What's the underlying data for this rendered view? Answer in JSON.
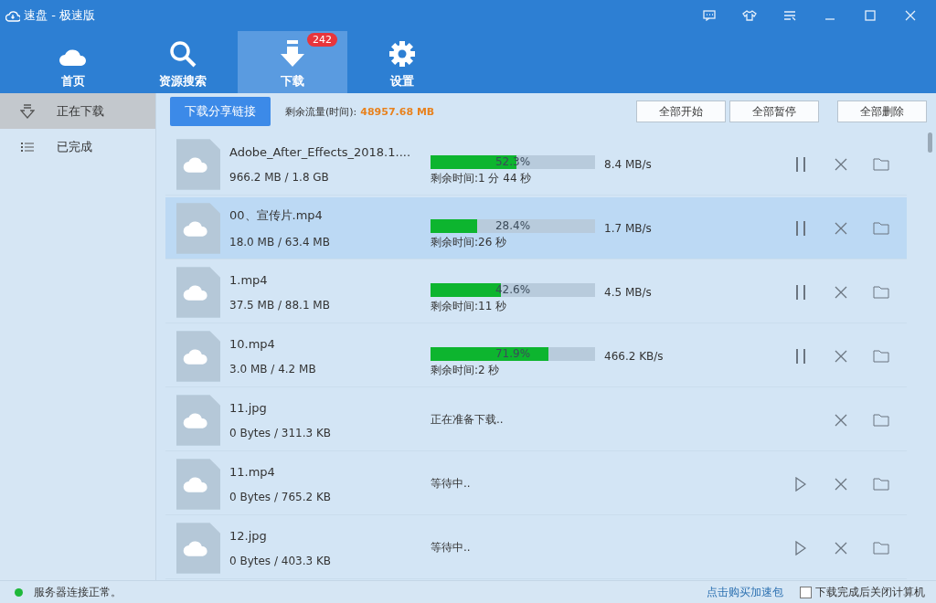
{
  "window": {
    "title": "速盘 - 极速版"
  },
  "nav": [
    {
      "label": "首页",
      "selected": false
    },
    {
      "label": "资源搜索",
      "selected": false
    },
    {
      "label": "下载",
      "selected": true,
      "badge": "242"
    },
    {
      "label": "设置",
      "selected": false
    }
  ],
  "sidebar": {
    "items": [
      {
        "label": "正在下载",
        "selected": true
      },
      {
        "label": "已完成",
        "selected": false
      }
    ]
  },
  "toolbar": {
    "share_button": "下载分享链接",
    "quota_label": "剩余流量(时间):",
    "quota_value": "48957.68 MB",
    "buttons": [
      "全部开始",
      "全部暂停",
      "全部删除"
    ]
  },
  "downloads": [
    {
      "name": "Adobe_After_Effects_2018.1....",
      "size": "966.2 MB / 1.8 GB",
      "kind": "downloading",
      "level": 0.523,
      "percent": "52.3%",
      "remaining": "剩余时间:1 分 44 秒",
      "speed": "8.4 MB/s",
      "selected": false
    },
    {
      "name": "00、宣传片.mp4",
      "size": "18.0 MB / 63.4 MB",
      "kind": "downloading",
      "level": 0.284,
      "percent": "28.4%",
      "remaining": "剩余时间:26 秒",
      "speed": "1.7 MB/s",
      "selected": true
    },
    {
      "name": "1.mp4",
      "size": "37.5 MB / 88.1 MB",
      "kind": "downloading",
      "level": 0.426,
      "percent": "42.6%",
      "remaining": "剩余时间:11 秒",
      "speed": "4.5 MB/s",
      "selected": false
    },
    {
      "name": "10.mp4",
      "size": "3.0 MB / 4.2 MB",
      "kind": "downloading",
      "level": 0.719,
      "percent": "71.9%",
      "remaining": "剩余时间:2 秒",
      "speed": "466.2 KB/s",
      "selected": false
    },
    {
      "name": "11.jpg",
      "size": "0 Bytes / 311.3 KB",
      "kind": "preparing",
      "status": "正在准备下载..",
      "selected": false
    },
    {
      "name": "11.mp4",
      "size": "0 Bytes / 765.2 KB",
      "kind": "waiting",
      "status": "等待中..",
      "selected": false
    },
    {
      "name": "12.jpg",
      "size": "0 Bytes / 403.3 KB",
      "kind": "waiting",
      "status": "等待中..",
      "selected": false
    }
  ],
  "status_bar": {
    "connection": "服务器连接正常。",
    "connected": true,
    "buy_link": "点击购买加速包",
    "shutdown_option": {
      "label": "下载完成后关闭计算机",
      "checked": false
    }
  }
}
